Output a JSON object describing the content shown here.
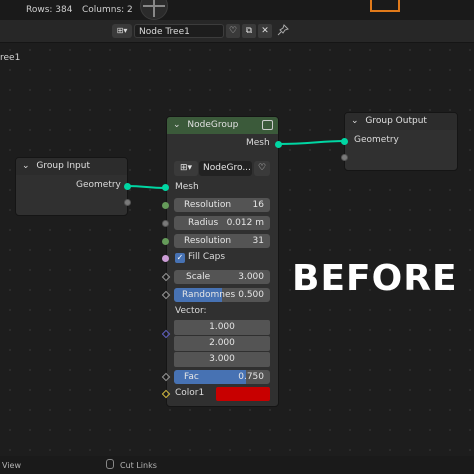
{
  "top": {
    "rows": "Rows: 384",
    "columns": "Columns: 2"
  },
  "header": {
    "type_icon": "⊞▾",
    "tree_name": "Node Tree1",
    "shield": "♡",
    "copy": "⧉",
    "close": "✕",
    "pin": "📌"
  },
  "editor": {
    "tree_label": "ree1"
  },
  "group_input": {
    "title": "Group Input",
    "outputs": [
      "Geometry"
    ]
  },
  "group_output": {
    "title": "Group Output",
    "inputs": [
      "Geometry"
    ]
  },
  "node_group": {
    "title": "NodeGroup",
    "output": "Mesh",
    "selector_label": "NodeGro...",
    "input_mesh": "Mesh",
    "resolution1": {
      "label": "Resolution",
      "value": "16"
    },
    "radius": {
      "label": "Radius",
      "value": "0.012 m"
    },
    "resolution2": {
      "label": "Resolution",
      "value": "31"
    },
    "fill_caps": "Fill Caps",
    "scale": {
      "label": "Scale",
      "value": "3.000"
    },
    "randomness": {
      "label": "Randomnes",
      "value": "0.500"
    },
    "vector_label": "Vector:",
    "vector": [
      "1.000",
      "2.000",
      "3.000"
    ],
    "fac": {
      "label": "Fac",
      "value": "0.750"
    },
    "color_label": "Color1"
  },
  "overlay": {
    "before": "BEFORE"
  },
  "status": {
    "view": "View",
    "cut_links": "Cut Links"
  },
  "colors": {
    "accent_teal": "#00d6a3",
    "node_group_header": "#3b5a3a",
    "group_header": "#2c2c2c",
    "fill_caps_check": "#4772b3",
    "color_swatch": "#c80000"
  }
}
